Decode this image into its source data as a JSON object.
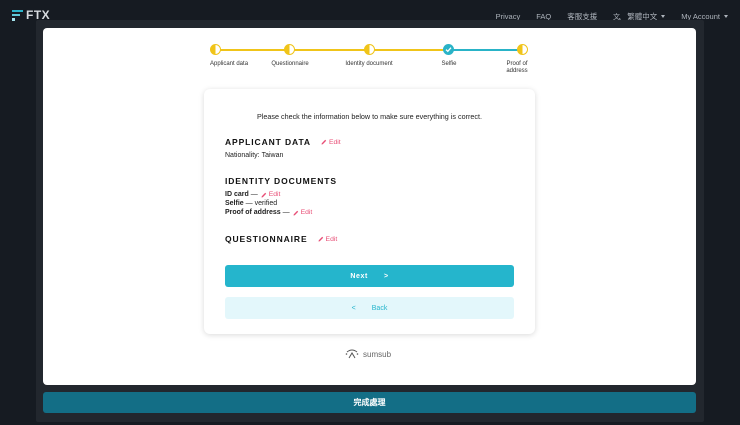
{
  "brand": {
    "name": "FTX"
  },
  "nav": {
    "privacy": "Privacy",
    "faq": "FAQ",
    "support": "客服支援",
    "language": "繁體中文",
    "account": "My Account"
  },
  "stepper": {
    "steps": [
      {
        "label": "Applicant data",
        "state": "in-progress"
      },
      {
        "label": "Questionnaire",
        "state": "in-progress"
      },
      {
        "label": "Identity document",
        "state": "in-progress"
      },
      {
        "label": "Selfie",
        "state": "complete"
      },
      {
        "label": "Proof of address",
        "state": "in-progress"
      }
    ],
    "colors": {
      "progress": "#f0c419",
      "complete": "#29b3c7"
    }
  },
  "review": {
    "intro": "Please check the information below to make sure everything is correct.",
    "applicant": {
      "title": "APPLICANT DATA",
      "edit": "Edit",
      "nationality_label": "Nationality:",
      "nationality_value": "Taiwan"
    },
    "documents": {
      "title": "IDENTITY DOCUMENTS",
      "id_card": {
        "label": "ID card",
        "sep": "—",
        "edit": "Edit"
      },
      "selfie": {
        "label": "Selfie",
        "status": "— verified"
      },
      "proof": {
        "label": "Proof of address",
        "sep": "—",
        "edit": "Edit"
      }
    },
    "questionnaire": {
      "title": "QUESTIONNAIRE",
      "edit": "Edit"
    },
    "next": {
      "label": "Next",
      "arrow": ">"
    },
    "back": {
      "label": "Back",
      "arrow": "<"
    }
  },
  "powered_by": "sumsub",
  "footer": {
    "label": "完成處理"
  },
  "colors": {
    "accent": "#25b5cc",
    "edit": "#e84e76",
    "footer": "#136e86"
  }
}
